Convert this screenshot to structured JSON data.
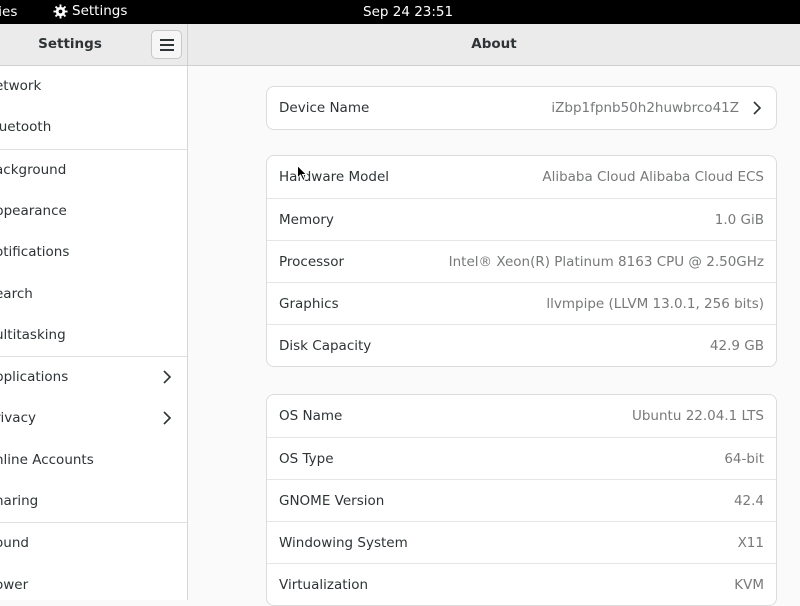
{
  "topbar": {
    "activities_label": "ties",
    "app_label": "Settings",
    "clock": "Sep 24  23:51"
  },
  "sidebar": {
    "title": "Settings",
    "items": [
      {
        "label": "etwork",
        "chevron": false
      },
      {
        "label": "luetooth",
        "chevron": false
      },
      {
        "label": "ackground",
        "chevron": false
      },
      {
        "label": "ppearance",
        "chevron": false
      },
      {
        "label": "otifications",
        "chevron": false
      },
      {
        "label": "earch",
        "chevron": false
      },
      {
        "label": "ultitasking",
        "chevron": false
      },
      {
        "label": "pplications",
        "chevron": true
      },
      {
        "label": "rivacy",
        "chevron": true
      },
      {
        "label": "nline Accounts",
        "chevron": false
      },
      {
        "label": "haring",
        "chevron": false
      },
      {
        "label": "ound",
        "chevron": false
      },
      {
        "label": "ower",
        "chevron": false
      }
    ]
  },
  "main": {
    "title": "About",
    "device": {
      "label": "Device Name",
      "value": "iZbp1fpnb50h2huwbrco41Z"
    },
    "hardware": [
      {
        "label": "Hardware Model",
        "value": "Alibaba Cloud Alibaba Cloud ECS"
      },
      {
        "label": "Memory",
        "value": "1.0 GiB"
      },
      {
        "label": "Processor",
        "value": "Intel® Xeon(R) Platinum 8163 CPU @ 2.50GHz"
      },
      {
        "label": "Graphics",
        "value": "llvmpipe (LLVM 13.0.1, 256 bits)"
      },
      {
        "label": "Disk Capacity",
        "value": "42.9 GB"
      }
    ],
    "os": [
      {
        "label": "OS Name",
        "value": "Ubuntu 22.04.1 LTS"
      },
      {
        "label": "OS Type",
        "value": "64-bit"
      },
      {
        "label": "GNOME Version",
        "value": "42.4"
      },
      {
        "label": "Windowing System",
        "value": "X11"
      },
      {
        "label": "Virtualization",
        "value": "KVM"
      }
    ]
  }
}
